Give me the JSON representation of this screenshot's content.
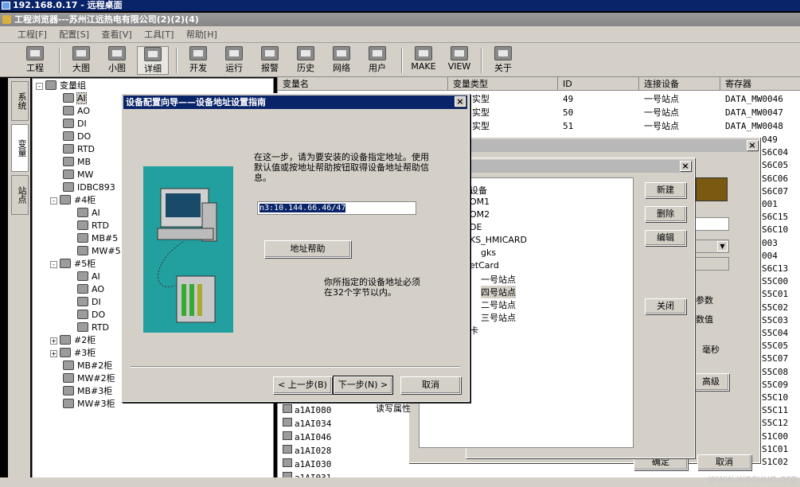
{
  "remote_title": "192.168.0.17 - 远程桌面",
  "app_title": "工程浏览器---苏州江远热电有限公司(2)(2)(4)",
  "menu": [
    "工程[F]",
    "配置[S]",
    "查看[V]",
    "工具[T]",
    "帮助[H]"
  ],
  "toolbar": [
    "工程",
    "大图",
    "小图",
    "详细",
    "开发",
    "运行",
    "报警",
    "历史",
    "网络",
    "用户",
    "MAKE",
    "VIEW",
    "关于"
  ],
  "vtabs": [
    "系统",
    "变量",
    "站点"
  ],
  "tree": [
    "变量组",
    "AI",
    "AO",
    "DI",
    "DO",
    "RTD",
    "MB",
    "MW",
    "IDBC893",
    "#4柜",
    "AI",
    "RTD",
    "MB#5",
    "MW#5",
    "#5柜",
    "AI",
    "AO",
    "DI",
    "DO",
    "RTD",
    "#2柜",
    "#3柜",
    "MB#2柜",
    "MW#2柜",
    "MB#3柜",
    "MW#3柜"
  ],
  "table": {
    "headers": [
      "变量名",
      "变量类型",
      "ID",
      "连接设备",
      "寄存器"
    ],
    "rows": [
      {
        "type": "实型",
        "id": "49",
        "device": "一号站点",
        "reg": "DATA_MW0046"
      },
      {
        "type": "实型",
        "id": "50",
        "device": "一号站点",
        "reg": "DATA_MW0047"
      },
      {
        "type": "实型",
        "id": "51",
        "device": "一号站点",
        "reg": "DATA_MW0048"
      }
    ],
    "reg_tail": [
      "049",
      "S6C04",
      "S6C05",
      "S6C06",
      "S6C07",
      "001",
      "S6C15",
      "S6C10",
      "003",
      "004",
      "S6C13",
      "S5C00",
      "S5C01",
      "S5C02",
      "S5C03",
      "S5C04",
      "S5C05",
      "S5C07",
      "S5C08",
      "S5C09",
      "S5C10",
      "S5C11",
      "S5C12",
      "S1C00",
      "S1C01",
      "S1C02"
    ],
    "bottom_names": [
      "a1AI080",
      "a1AI034",
      "a1AI046",
      "a1AI028",
      "a1AI030",
      "a1AI031"
    ]
  },
  "dlgB": {
    "list": [
      "设备",
      "OM1",
      "OM2",
      "DE",
      "KS_HMICARD",
      "gks",
      "etCard",
      "一号站点",
      "四号站点",
      "二号站点",
      "三号站点",
      "卡"
    ],
    "buttons": [
      "新建",
      "删除",
      "编辑",
      "关闭"
    ]
  },
  "dlgA": {
    "labels": [
      "参数",
      "数值",
      "毫秒",
      "高级",
      "读写属性"
    ],
    "buttons": [
      "确定",
      "取消"
    ]
  },
  "wizard": {
    "title": "设备配置向导——设备地址设置指南",
    "instr": "在这一步，请为要安装的设备指定地址。使用默认值或按地址帮助按钮取得设备地址帮助信息。",
    "address": "n3:10.144.66.46/47",
    "help_button": "地址帮助",
    "note": "你所指定的设备地址必须在32个字节以内。",
    "back": "< 上一步(B)",
    "next": "下一步(N) >",
    "cancel": "取消"
  },
  "watermark": "www.wocuun.org"
}
